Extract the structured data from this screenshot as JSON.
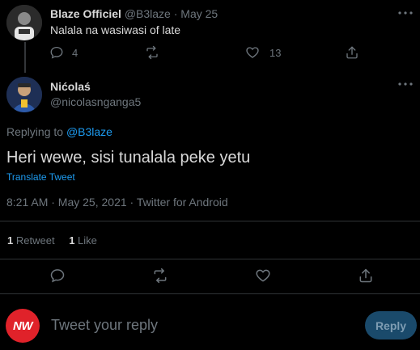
{
  "parent_tweet": {
    "author_name": "Blaze Officiel",
    "handle": "@B3laze",
    "separator": "·",
    "date": "May 25",
    "text": "Nalala na wasiwasi of late",
    "reply_count": "4",
    "like_count": "13"
  },
  "main_tweet": {
    "author_name": "Nićolaś",
    "handle": "@nicolasnganga5",
    "replying_prefix": "Replying to",
    "replying_handle": "@B3laze",
    "text": "Heri wewe, sisi tunalala peke yetu",
    "translate_label": "Translate Tweet",
    "timestamp": "8:21 AM · May 25, 2021 · Twitter for Android",
    "retweet_count": "1",
    "retweet_label": "Retweet",
    "like_count": "1",
    "like_label": "Like"
  },
  "reply_box": {
    "avatar_text": "NW",
    "placeholder": "Tweet your reply",
    "reply_button": "Reply"
  },
  "colors": {
    "background": "#000000",
    "accent": "#1d9bf0",
    "muted": "#6e767d",
    "reply_avatar": "#e0222a",
    "reply_button_bg": "#1a4a6b"
  },
  "icons": [
    "more-icon",
    "reply-icon",
    "retweet-icon",
    "like-icon",
    "share-icon"
  ]
}
